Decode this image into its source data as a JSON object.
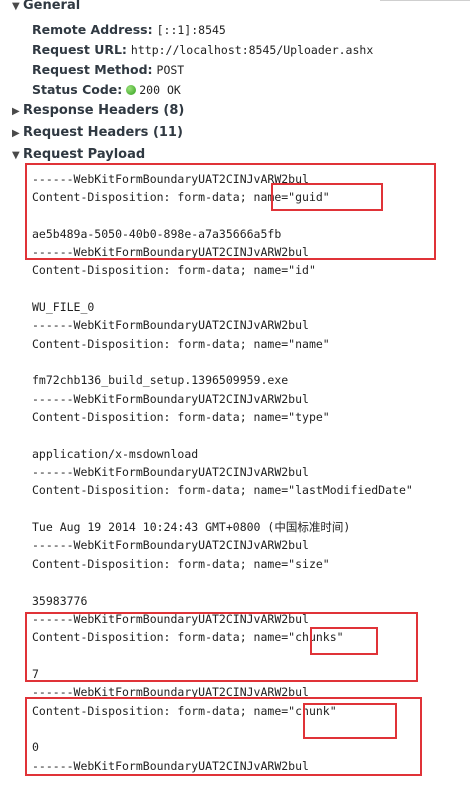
{
  "general": {
    "title": "General",
    "remote_address_label": "Remote Address:",
    "remote_address": "[::1]:8545",
    "request_url_label": "Request URL:",
    "request_url": "http://localhost:8545/Uploader.ashx",
    "request_method_label": "Request Method:",
    "request_method": "POST",
    "status_code_label": "Status Code:",
    "status_code": "200 OK",
    "status_color": "#2f9e1c"
  },
  "sections": {
    "response_headers": "Response Headers (8)",
    "request_headers": "Request Headers (11)",
    "request_payload": "Request Payload"
  },
  "payload": [
    "------WebKitFormBoundaryUAT2CINJvARW2bul",
    "Content-Disposition: form-data; name=\"guid\"",
    "",
    "ae5b489a-5050-40b0-898e-a7a35666a5fb",
    "------WebKitFormBoundaryUAT2CINJvARW2bul",
    "Content-Disposition: form-data; name=\"id\"",
    "",
    "WU_FILE_0",
    "------WebKitFormBoundaryUAT2CINJvARW2bul",
    "Content-Disposition: form-data; name=\"name\"",
    "",
    "fm72chb136_build_setup.1396509959.exe",
    "------WebKitFormBoundaryUAT2CINJvARW2bul",
    "Content-Disposition: form-data; name=\"type\"",
    "",
    "application/x-msdownload",
    "------WebKitFormBoundaryUAT2CINJvARW2bul",
    "Content-Disposition: form-data; name=\"lastModifiedDate\"",
    "",
    "Tue Aug 19 2014 10:24:43 GMT+0800 (中国标准时间)",
    "------WebKitFormBoundaryUAT2CINJvARW2bul",
    "Content-Disposition: form-data; name=\"size\"",
    "",
    "35983776",
    "------WebKitFormBoundaryUAT2CINJvARW2bul",
    "Content-Disposition: form-data; name=\"chunks\"",
    "",
    "7",
    "------WebKitFormBoundaryUAT2CINJvARW2bul",
    "Content-Disposition: form-data; name=\"chunk\"",
    "",
    "0",
    "------WebKitFormBoundaryUAT2CINJvARW2bul"
  ],
  "annotation_color": "#e03338"
}
